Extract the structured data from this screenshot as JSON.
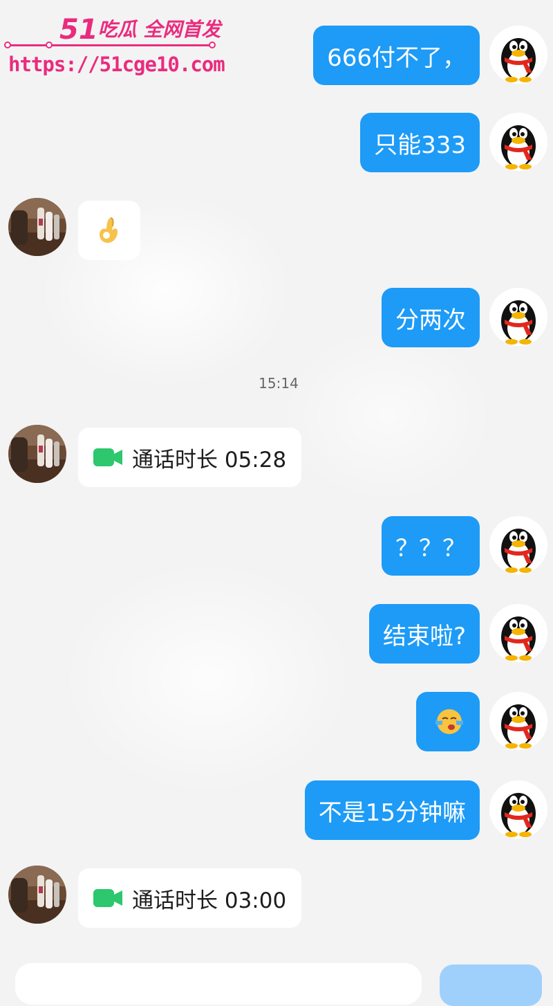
{
  "watermark": {
    "brand_num": "51",
    "brand_text": "吃瓜 全网首发",
    "url": "https://51cge10.com"
  },
  "colors": {
    "bubble_me": "#1d9bf7",
    "bubble_other": "#ffffff",
    "watermark": "#ea2b7d",
    "call_icon": "#2dc76d"
  },
  "messages": [
    {
      "side": "me",
      "text": "666付不了，"
    },
    {
      "side": "me",
      "text": "只能333"
    },
    {
      "side": "other",
      "kind": "emoji",
      "icon": "ok-hand-emoji"
    },
    {
      "side": "me",
      "text": "分两次"
    },
    {
      "side": "other",
      "kind": "call",
      "text": "通话时长 05:28"
    },
    {
      "side": "me",
      "text": "？？？"
    },
    {
      "side": "me",
      "text": "结束啦?"
    },
    {
      "side": "me",
      "kind": "emoji",
      "icon": "crying-face-emoji"
    },
    {
      "side": "me",
      "text": "不是15分钟嘛"
    },
    {
      "side": "other",
      "kind": "call",
      "text": "通话时长 03:00"
    }
  ],
  "timestamp": "15:14",
  "avatars": {
    "me": "qq-penguin-avatar",
    "other": "photo-avatar"
  }
}
